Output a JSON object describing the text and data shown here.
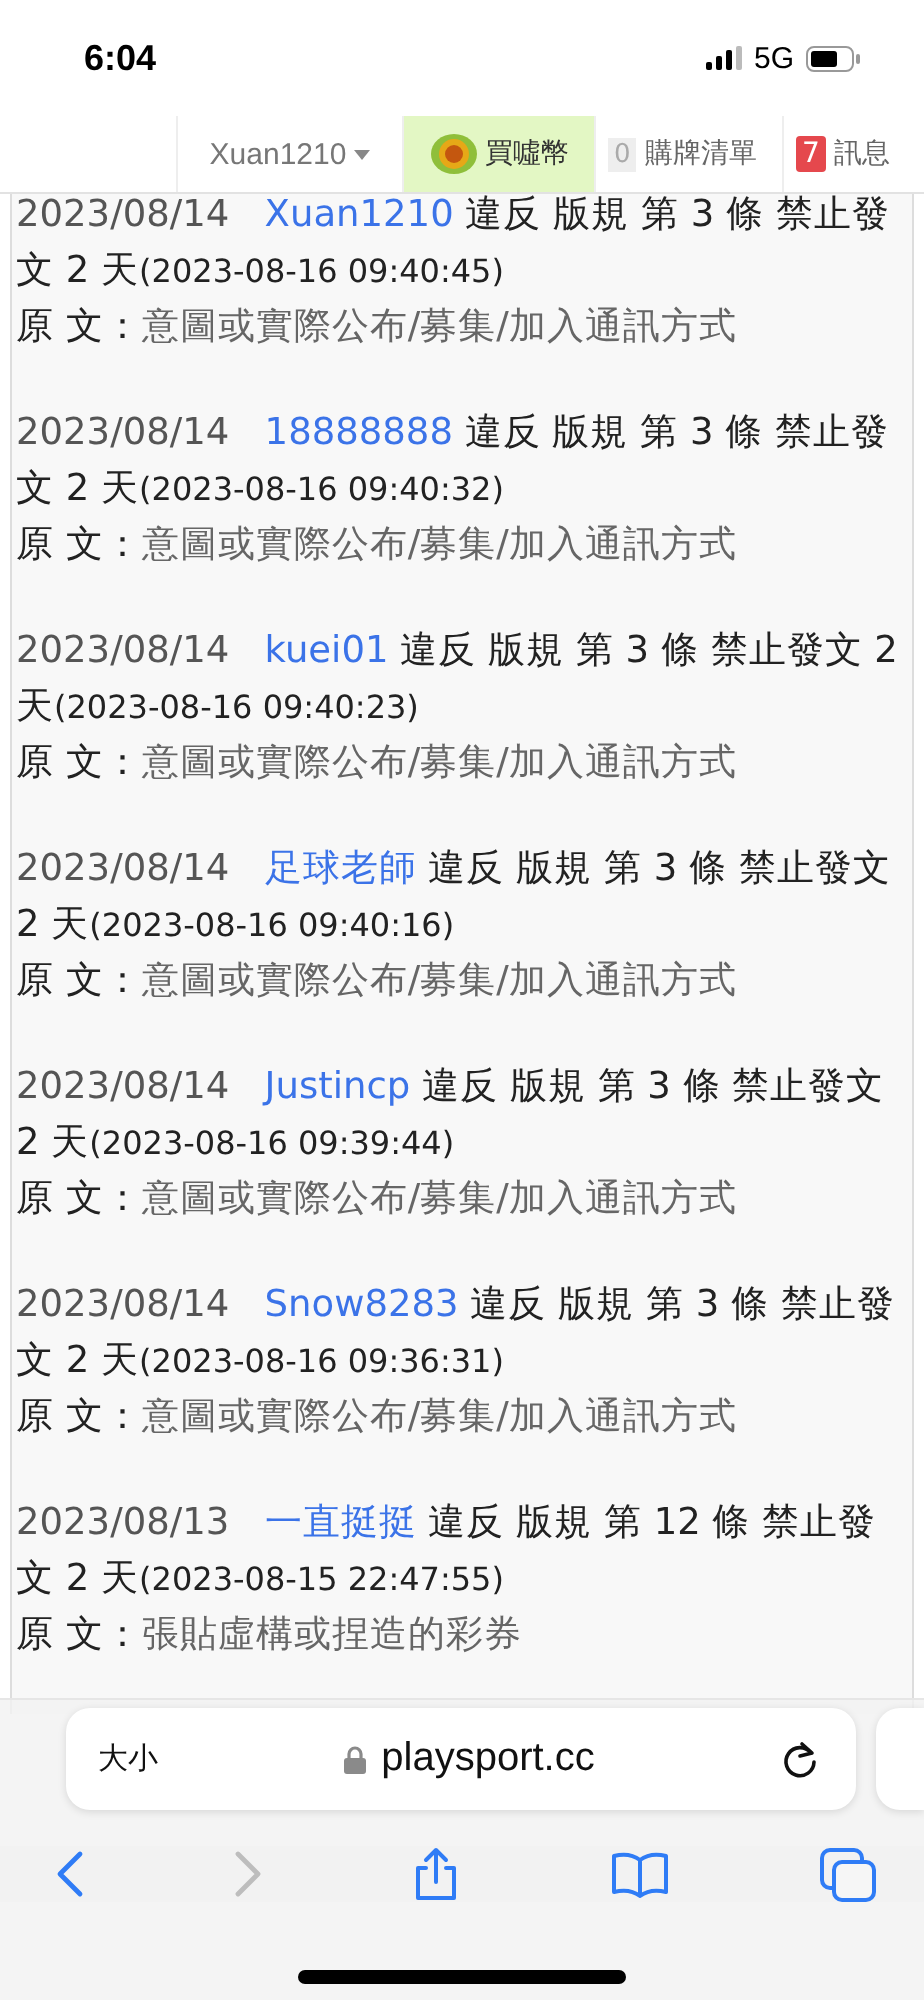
{
  "status_bar": {
    "time": "6:04",
    "network": "5G"
  },
  "nav": {
    "user": "Xuan1210",
    "buy_coins": "買噓幣",
    "cart": {
      "count": "0",
      "label": "購牌清單"
    },
    "messages": {
      "count": "7",
      "label": "訊息"
    }
  },
  "entries": [
    {
      "date": "2023/08/14",
      "user": "Xuan1210",
      "rule": "違反 版規 第 3 條 禁止發文 2 天",
      "until": "(2023-08-16 09:40:45)",
      "reason_label": "原 文：",
      "reason": "意圖或實際公布/募集/加入通訊方式"
    },
    {
      "date": "2023/08/14",
      "user": "18888888",
      "rule": "違反 版規 第 3 條 禁止發文 2 天",
      "until": "(2023-08-16 09:40:32)",
      "reason_label": "原 文：",
      "reason": "意圖或實際公布/募集/加入通訊方式"
    },
    {
      "date": "2023/08/14",
      "user": "kuei01",
      "rule": "違反 版規 第 3 條 禁止發文 2 天",
      "until": "(2023-08-16 09:40:23)",
      "reason_label": "原 文：",
      "reason": "意圖或實際公布/募集/加入通訊方式"
    },
    {
      "date": "2023/08/14",
      "user": "足球老師",
      "rule": "違反 版規 第 3 條 禁止發文 2 天",
      "until": "(2023-08-16 09:40:16)",
      "reason_label": "原 文：",
      "reason": "意圖或實際公布/募集/加入通訊方式"
    },
    {
      "date": "2023/08/14",
      "user": "Justincp",
      "rule": "違反 版規 第 3 條 禁止發文 2 天",
      "until": "(2023-08-16 09:39:44)",
      "reason_label": "原 文：",
      "reason": "意圖或實際公布/募集/加入通訊方式"
    },
    {
      "date": "2023/08/14",
      "user": "Snow8283",
      "rule": "違反 版規 第 3 條 禁止發文 2 天",
      "until": "(2023-08-16 09:36:31)",
      "reason_label": "原 文：",
      "reason": "意圖或實際公布/募集/加入通訊方式"
    },
    {
      "date": "2023/08/13",
      "user": "一直挺挺",
      "rule": "違反 版規 第 12 條 禁止發文 2 天",
      "until": "(2023-08-15 22:47:55)",
      "reason_label": "原 文：",
      "reason": "張貼虛構或捏造的彩券"
    }
  ],
  "browser": {
    "text_size": "大小",
    "url": "playsport.cc"
  }
}
